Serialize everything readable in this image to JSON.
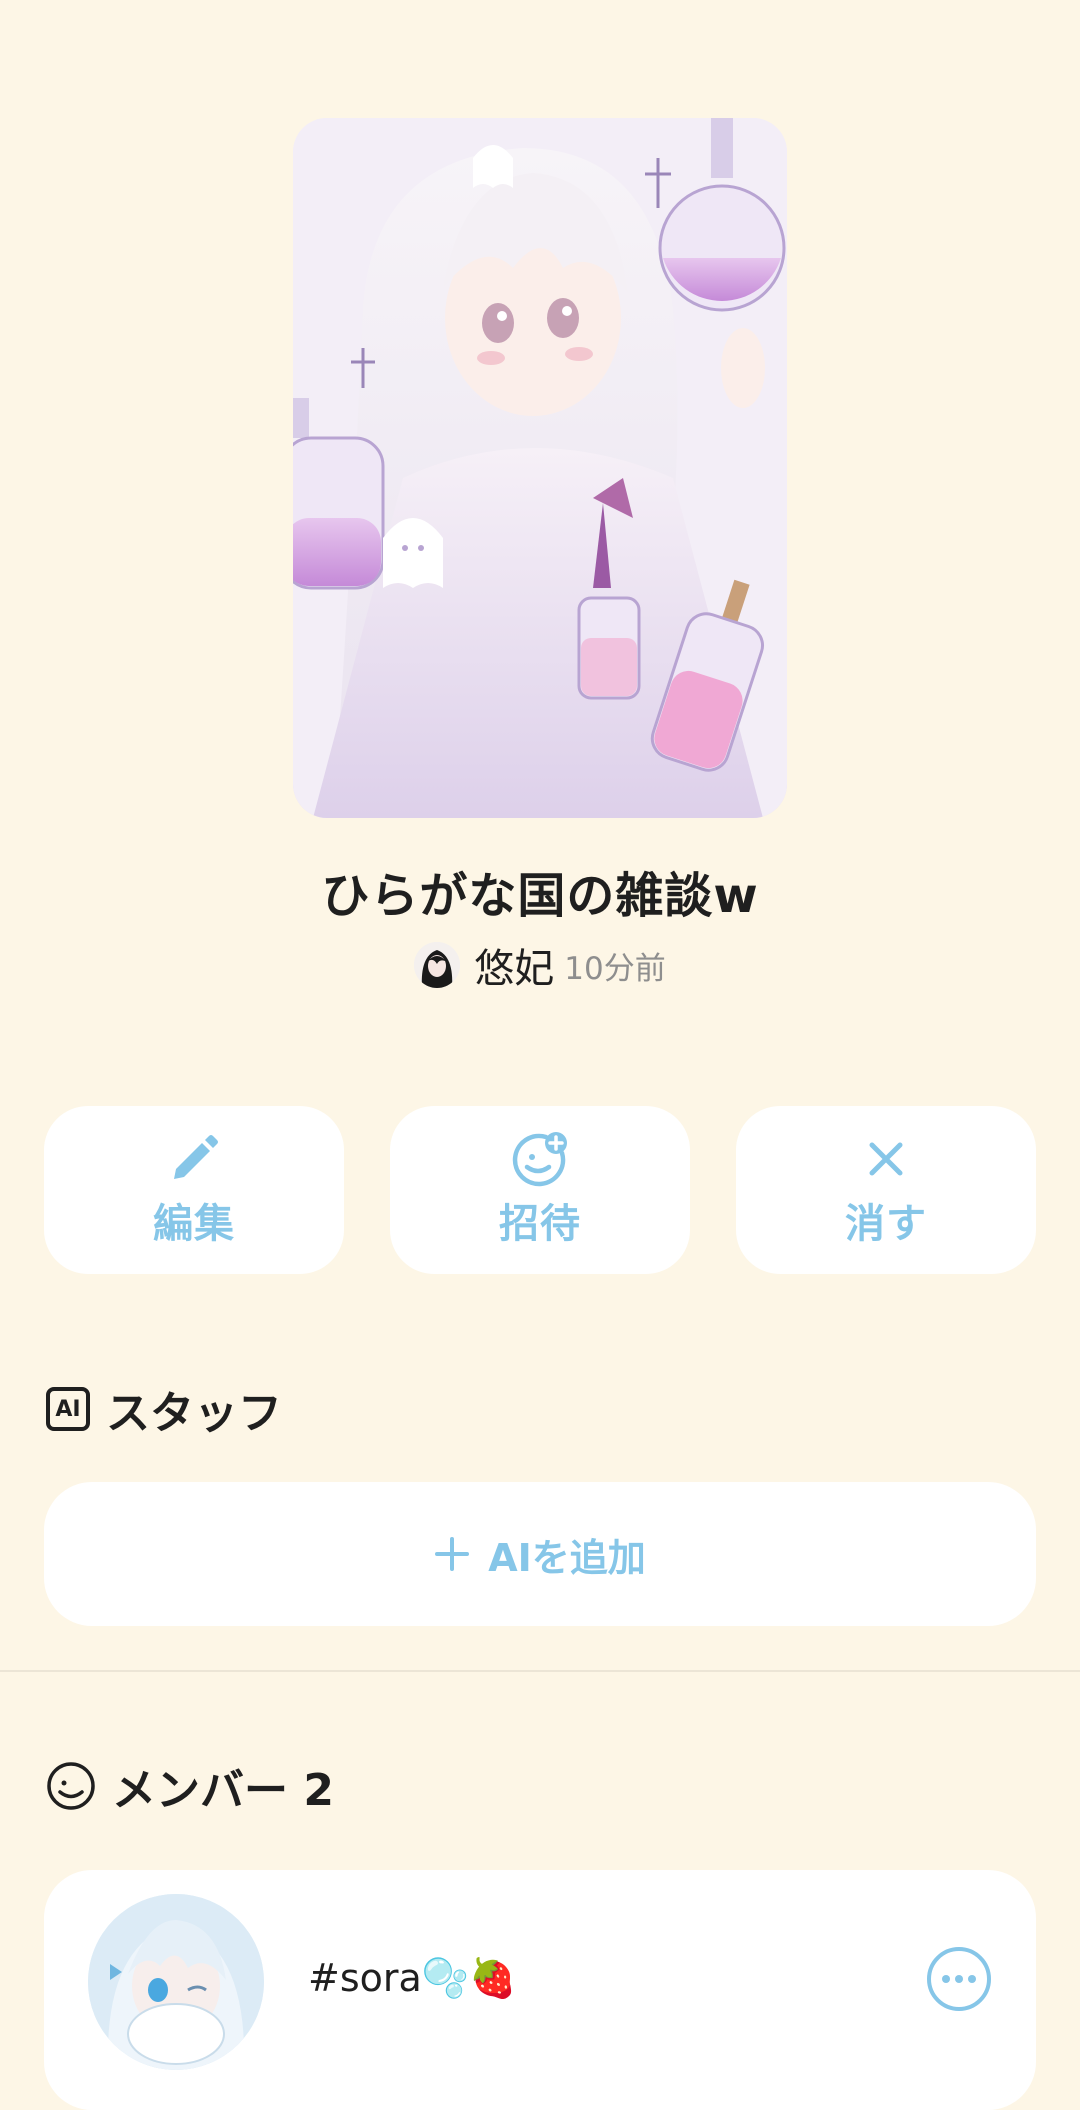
{
  "room": {
    "title": "ひらがな国の雑談w",
    "author_name": "悠妃",
    "author_time": "10分前"
  },
  "actions": [
    {
      "label": "編集",
      "icon": "pencil-icon"
    },
    {
      "label": "招待",
      "icon": "face-plus-icon"
    },
    {
      "label": "消す",
      "icon": "close-icon"
    }
  ],
  "staff": {
    "badge": "AI",
    "title": "スタッフ",
    "add_label": "AIを追加"
  },
  "members": {
    "title": "メンバー 2",
    "list": [
      {
        "name": "#sora🫧🍓"
      }
    ]
  },
  "colors": {
    "background": "#fdf6e6",
    "accent": "#86c6e8",
    "card": "#ffffff"
  }
}
